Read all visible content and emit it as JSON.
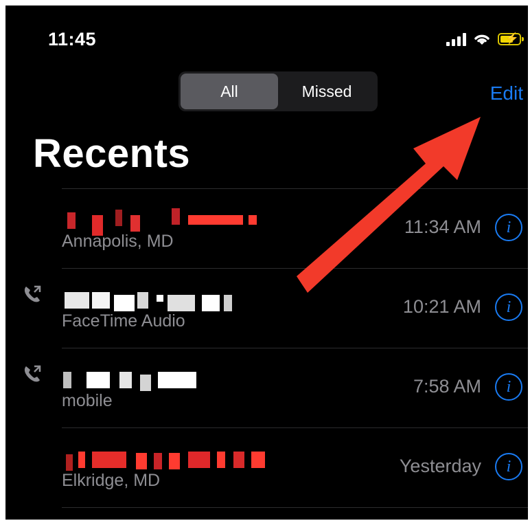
{
  "status_bar": {
    "time": "11:45"
  },
  "segmented_control": {
    "all_label": "All",
    "missed_label": "Missed"
  },
  "header": {
    "edit_label": "Edit",
    "title": "Recents"
  },
  "calls": [
    {
      "subtitle": "Annapolis, MD",
      "time": "11:34 AM",
      "facetime": false
    },
    {
      "subtitle": "FaceTime Audio",
      "time": "10:21 AM",
      "facetime": true
    },
    {
      "subtitle": "mobile",
      "time": "7:58 AM",
      "facetime": true
    },
    {
      "subtitle": "Elkridge, MD",
      "time": "Yesterday",
      "facetime": false
    }
  ],
  "colors": {
    "accent": "#1a7bf2",
    "annotation_arrow": "#f23a2a",
    "redaction_red": "#ff3b30"
  },
  "icons": {
    "info": "info-circle-icon",
    "call_type": "phone-outgoing-icon"
  }
}
